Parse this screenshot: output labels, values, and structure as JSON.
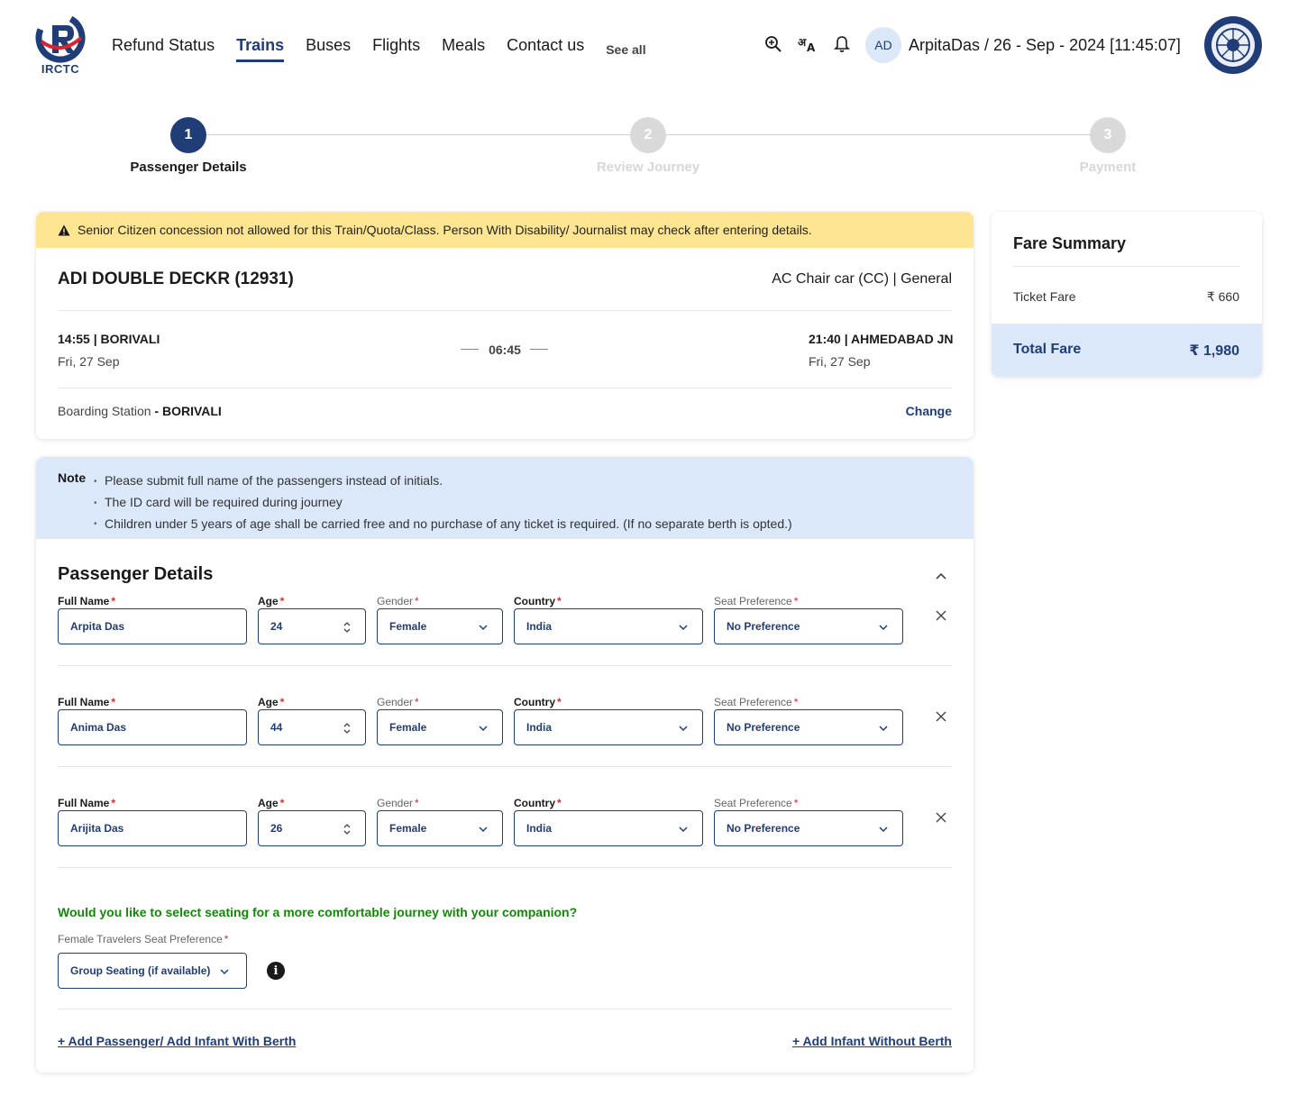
{
  "header": {
    "logo_text": "IRCTC",
    "nav": [
      {
        "label": "Refund Status",
        "active": false
      },
      {
        "label": "Trains",
        "active": true
      },
      {
        "label": "Buses",
        "active": false
      },
      {
        "label": "Flights",
        "active": false
      },
      {
        "label": "Meals",
        "active": false
      },
      {
        "label": "Contact us",
        "active": false
      }
    ],
    "see_all": "See all",
    "icons": [
      "zoom-in-icon",
      "translate-icon",
      "bell-icon"
    ],
    "avatar_initials": "AD",
    "user_info": "ArpitaDas / 26 - Sep - 2024 [11:45:07]"
  },
  "stepper": {
    "steps": [
      {
        "number": "1",
        "label": "Passenger Details",
        "state": "active"
      },
      {
        "number": "2",
        "label": "Review Journey",
        "state": "inactive"
      },
      {
        "number": "3",
        "label": "Payment",
        "state": "inactive"
      }
    ]
  },
  "journey": {
    "alert": "Senior Citizen concession not allowed for this Train/Quota/Class. Person With Disability/ Journalist may check after entering details.",
    "train_name": "ADI DOUBLE DECKR (12931)",
    "class_info": "AC Chair car (CC) | General",
    "departure_time": "14:55 | BORIVALI",
    "departure_date": "Fri, 27 Sep",
    "duration": "06:45",
    "arrival_time": "21:40 | AHMEDABAD JN",
    "arrival_date": "Fri, 27 Sep",
    "boarding_label": "Boarding Station",
    "boarding_station": "- BORIVALI",
    "change_label": "Change"
  },
  "note": {
    "label": "Note",
    "items": [
      "Please submit full name of the passengers instead of initials.",
      "The ID card will be required during journey",
      "Children under 5 years of age shall be carried free and no purchase of any ticket is required. (If no separate berth is opted.)"
    ]
  },
  "passenger_details": {
    "title": "Passenger Details",
    "labels": {
      "full_name": "Full Name",
      "age": "Age",
      "gender": "Gender",
      "country": "Country",
      "seat_preference": "Seat Preference",
      "required_mark": "*"
    },
    "passengers": [
      {
        "full_name": "Arpita Das",
        "age": "24",
        "gender": "Female",
        "country": "India",
        "seat_preference": "No Preference"
      },
      {
        "full_name": "Anima Das",
        "age": "44",
        "gender": "Female",
        "country": "India",
        "seat_preference": "No Preference"
      },
      {
        "full_name": "Arijita Das",
        "age": "26",
        "gender": "Female",
        "country": "India",
        "seat_preference": "No Preference"
      }
    ],
    "companion_question": "Would you like to select seating for a more comfortable journey with your companion?",
    "female_seat_pref_label": "Female Travelers Seat Preference",
    "female_seat_pref_value": "Group Seating (if available)",
    "info_glyph": "i",
    "add_passenger_link": "+ Add Passenger/ Add Infant With Berth",
    "add_infant_link": "+ Add Infant Without Berth"
  },
  "fare_summary": {
    "title": "Fare Summary",
    "ticket_fare_label": "Ticket Fare",
    "ticket_fare_value": "₹ 660",
    "total_label": "Total Fare",
    "total_value": "₹ 1,980"
  },
  "colors": {
    "primary": "#213d77",
    "alert_bg": "#fde592",
    "note_bg": "#dbe8fa",
    "success_text": "#138808",
    "required": "#d32f2f"
  }
}
